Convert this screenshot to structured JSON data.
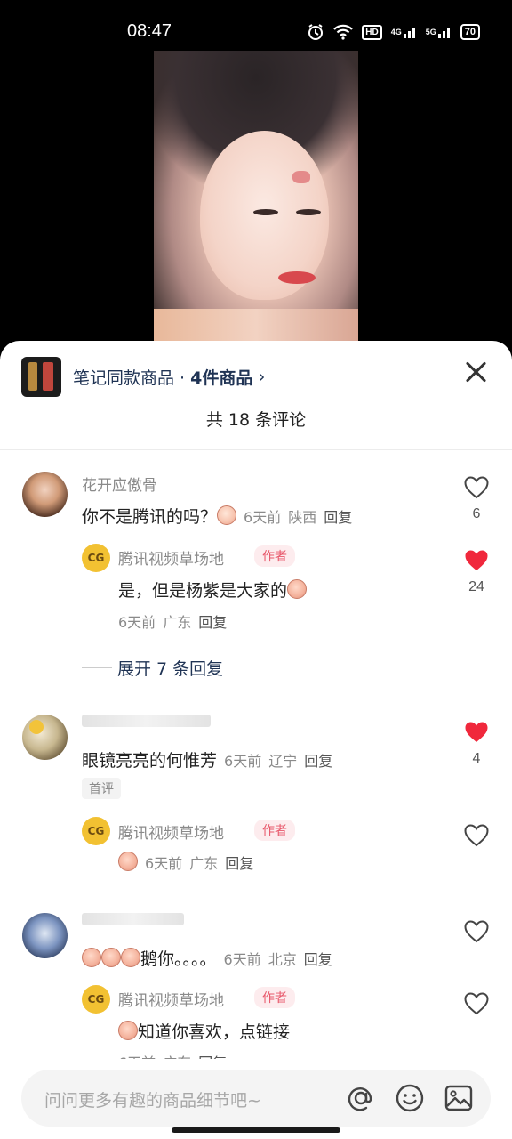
{
  "status_bar": {
    "time": "08:47",
    "network_a": "4G",
    "network_b": "5G",
    "hd": "HD",
    "battery": "70"
  },
  "product_bar": {
    "title": "笔记同款商品 · ",
    "count": "4件商品",
    "chevron": "›"
  },
  "comments_header": {
    "total": "共 18 条评论"
  },
  "comments": [
    {
      "username": "花开应傲骨",
      "text": "你不是腾讯的吗？",
      "time": "6天前",
      "location": "陕西",
      "reply": "回复",
      "likes": "6",
      "liked": false,
      "replies": [
        {
          "username": "腾讯视频草场地",
          "tag": "作者",
          "text": "是，但是杨紫是大家的",
          "time": "6天前",
          "location": "广东",
          "reply": "回复",
          "likes": "24",
          "liked": true
        }
      ],
      "expand_label": "展开 7 条回复"
    },
    {
      "username": "",
      "text": "眼镜亮亮的何惟芳",
      "time": "6天前",
      "location": "辽宁",
      "reply": "回复",
      "badge": "首评",
      "likes": "4",
      "liked": true,
      "replies": [
        {
          "username": "腾讯视频草场地",
          "tag": "作者",
          "text": "",
          "time": "6天前",
          "location": "广东",
          "reply": "回复",
          "liked": false
        }
      ]
    },
    {
      "username": "",
      "text": "鹅你。。。。",
      "time": "6天前",
      "location": "北京",
      "reply": "回复",
      "liked": false,
      "replies": [
        {
          "username": "腾讯视频草场地",
          "tag": "作者",
          "text": "知道你喜欢，点链接",
          "time": "6天前",
          "location": "广东",
          "reply": "回复",
          "liked": false
        }
      ]
    }
  ],
  "input": {
    "placeholder": "问问更多有趣的商品细节吧~"
  },
  "colors": {
    "heart_liked": "#f0283c",
    "accent_text": "#1f3354",
    "author_tag": "#e8576a"
  }
}
